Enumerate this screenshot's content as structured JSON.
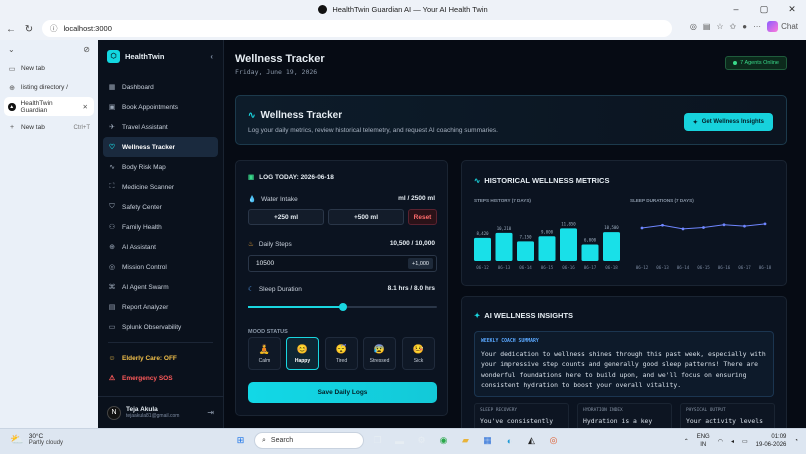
{
  "window": {
    "title": "HealthTwin Guardian AI — Your AI Health Twin"
  },
  "browser": {
    "url": "localhost:3000",
    "chat_label": "Chat",
    "tabs": [
      {
        "label": "New tab"
      },
      {
        "label": "listing directory /"
      },
      {
        "label": "HealthTwin Guardian"
      }
    ],
    "new_tab_label": "New tab",
    "new_tab_shortcut": "Ctrl+T"
  },
  "sidebar": {
    "brand": "HealthTwin",
    "items": [
      {
        "label": "Dashboard",
        "icon": "grid-icon"
      },
      {
        "label": "Book Appointments",
        "icon": "calendar-icon"
      },
      {
        "label": "Travel Assistant",
        "icon": "plane-icon"
      },
      {
        "label": "Wellness Tracker",
        "icon": "heart-icon"
      },
      {
        "label": "Body Risk Map",
        "icon": "pulse-icon"
      },
      {
        "label": "Medicine Scanner",
        "icon": "scan-icon"
      },
      {
        "label": "Safety Center",
        "icon": "shield-icon"
      },
      {
        "label": "Family Health",
        "icon": "users-icon"
      },
      {
        "label": "AI Assistant",
        "icon": "globe-icon"
      },
      {
        "label": "Mission Control",
        "icon": "target-icon"
      },
      {
        "label": "AI Agent Swarm",
        "icon": "network-icon"
      },
      {
        "label": "Report Analyzer",
        "icon": "document-icon"
      },
      {
        "label": "Splunk Observability",
        "icon": "monitor-icon"
      }
    ],
    "elderly_care": "Elderly Care: OFF",
    "emergency": "Emergency SOS",
    "user": {
      "initial": "N",
      "name": "Teja Akula",
      "email": "tejaakula81@gmail.com"
    }
  },
  "header": {
    "title": "Wellness Tracker",
    "date": "Friday, June 19, 2026",
    "agents_badge": "7 Agents Online"
  },
  "hero": {
    "title": "Wellness Tracker",
    "subtitle": "Log your daily metrics, review historical telemetry, and request AI coaching summaries.",
    "button": "Get Wellness Insights"
  },
  "log": {
    "title": "LOG TODAY: 2026-06-18",
    "water_label": "Water Intake",
    "water_value": "ml / 2500 ml",
    "btn_250": "+250 ml",
    "btn_500": "+500 ml",
    "btn_reset": "Reset",
    "steps_label": "Daily Steps",
    "steps_value": "10,500 / 10,000",
    "steps_input": "10500",
    "steps_plus": "+1,000",
    "sleep_label": "Sleep Duration",
    "sleep_value": "8.1 hrs / 8.0 hrs",
    "sleep_fraction": 0.5,
    "mood_label": "MOOD STATUS",
    "moods": [
      {
        "label": "Calm",
        "emoji": "🧘"
      },
      {
        "label": "Happy",
        "emoji": "😊"
      },
      {
        "label": "Tired",
        "emoji": "😴"
      },
      {
        "label": "Stressed",
        "emoji": "😰"
      },
      {
        "label": "Sick",
        "emoji": "🤒"
      }
    ],
    "selected_mood": "Happy",
    "save_button": "Save Daily Logs"
  },
  "history": {
    "title": "HISTORICAL WELLNESS METRICS",
    "steps_title": "STEPS HISTORY (7 DAYS)",
    "sleep_title": "SLEEP DURATIONS (7 DAYS)"
  },
  "chart_data": [
    {
      "type": "bar",
      "title": "STEPS HISTORY (7 DAYS)",
      "categories": [
        "06-12",
        "06-13",
        "06-14",
        "06-15",
        "06-16",
        "06-17",
        "06-18"
      ],
      "values": [
        8420,
        10210,
        7150,
        9000,
        11850,
        6000,
        10500
      ],
      "data_labels": [
        "8,420",
        "10,210",
        "7,150",
        "9,000",
        "11,850",
        "6,000",
        "10,500"
      ],
      "color": "#19e0e8"
    },
    {
      "type": "line",
      "title": "SLEEP DURATIONS (7 DAYS)",
      "categories": [
        "06-12",
        "06-13",
        "06-14",
        "06-15",
        "06-16",
        "06-17",
        "06-18"
      ],
      "values": [
        7.2,
        7.8,
        7.0,
        7.3,
        7.9,
        7.6,
        8.1
      ],
      "ylim": [
        0,
        12
      ],
      "color": "#6f86ff"
    }
  ],
  "insights": {
    "title": "AI WELLNESS INSIGHTS",
    "coach_label": "WEEKLY COACH SUMMARY",
    "coach_text": "Your dedication to wellness shines through this past week, especially with your impressive step counts and generally good sleep patterns! There are wonderful foundations here to build upon, and we'll focus on ensuring consistent hydration to boost your overall vitality.",
    "cards": [
      {
        "label": "SLEEP RECOVERY",
        "text": "You've consistently"
      },
      {
        "label": "HYDRATION INDEX",
        "text": "Hydration is a key"
      },
      {
        "label": "PHYSICAL OUTPUT",
        "text": "Your activity levels"
      }
    ]
  },
  "taskbar": {
    "temp": "30°C",
    "weather": "Partly cloudy",
    "search": "Search",
    "lang1": "ENG",
    "lang2": "IN",
    "time": "01:09",
    "date": "19-06-2026"
  }
}
